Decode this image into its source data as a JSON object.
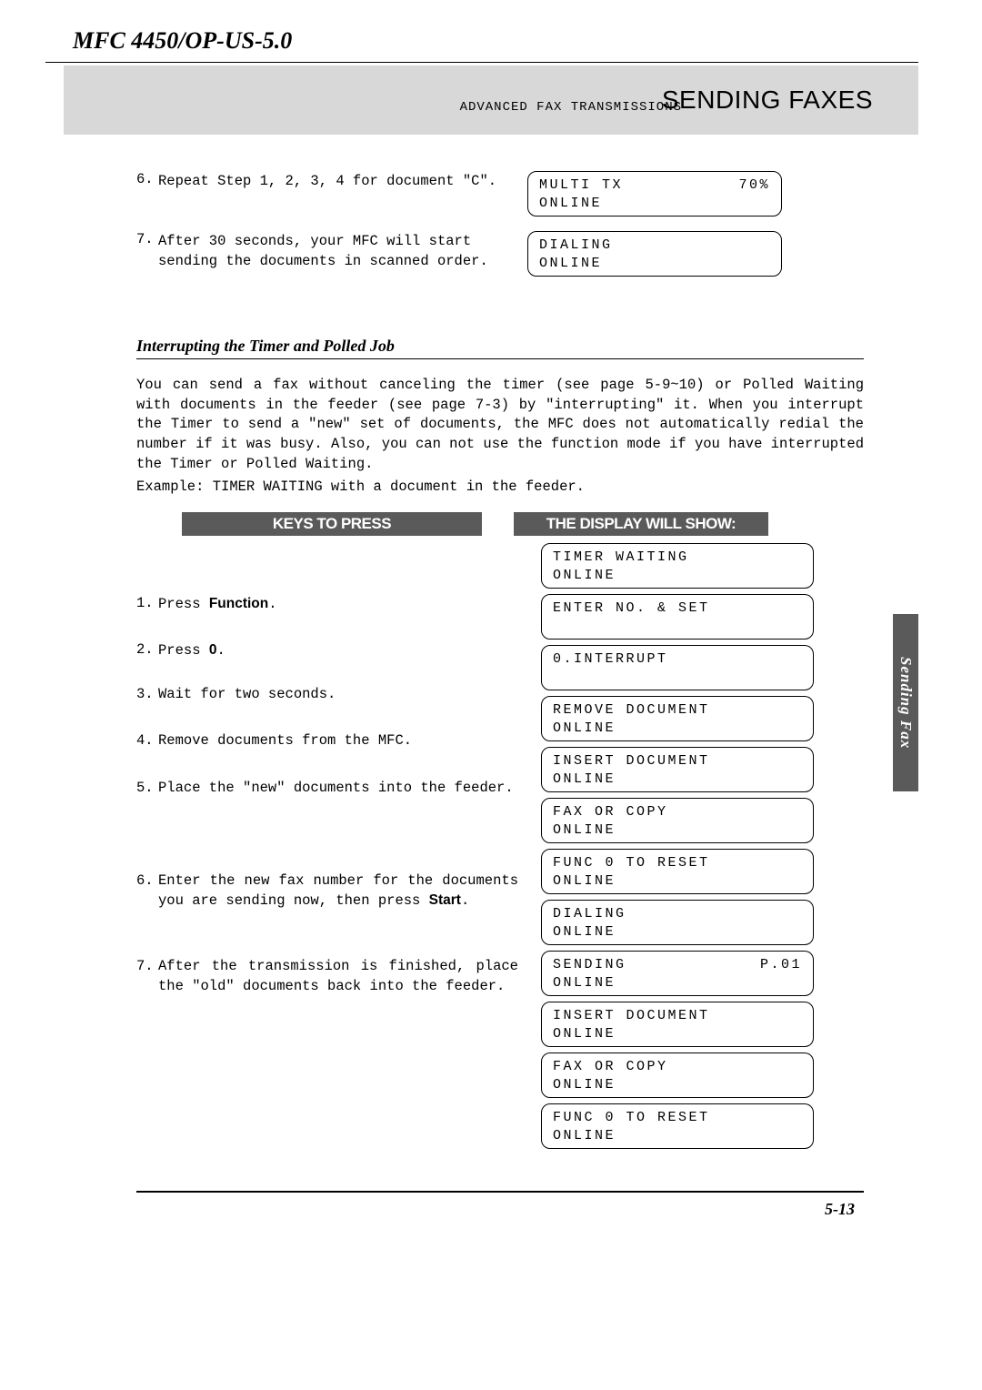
{
  "header": {
    "model": "MFC 4450/OP-US-5.0",
    "subheading": "ADVANCED FAX TRANSMISSIONS",
    "title": "SENDING FAXES"
  },
  "intro_steps": [
    {
      "n": "6.",
      "text_before": "Repeat Step 1, 2, 3, 4 for document ",
      "quoted": "\"C\"",
      "text_after": "."
    },
    {
      "n": "7.",
      "text_before": "After 30 seconds, your MFC will start sending the documents in scanned order.",
      "quoted": "",
      "text_after": ""
    }
  ],
  "intro_lcds": [
    {
      "line1_left": "MULTI TX",
      "line1_right": "70%",
      "line2": "ONLINE"
    },
    {
      "line1_left": "DIALING",
      "line1_right": "",
      "line2": "ONLINE"
    }
  ],
  "section": {
    "title": "Interrupting the Timer and Polled Job",
    "para1": "You can send a fax without canceling the timer (see page 5-9~10) or Polled Waiting with documents in the feeder (see page 7-3) by \"interrupting\" it. When you interrupt the Timer to send a \"new\" set of documents, the MFC does not automatically redial the number if it was busy. Also, you can not use the function mode if you have interrupted the Timer or Polled Waiting.",
    "para2": "Example: TIMER WAITING with a document in the feeder."
  },
  "table": {
    "left_header": "KEYS TO PRESS",
    "right_header": "THE DISPLAY WILL SHOW:"
  },
  "lcds": [
    {
      "l1": "TIMER  WAITING",
      "l2": "ONLINE"
    },
    {
      "l1": "ENTER  NO.  &  SET",
      "l2": ""
    },
    {
      "l1": "0.INTERRUPT",
      "l2": ""
    },
    {
      "l1": "REMOVE  DOCUMENT",
      "l2": "ONLINE"
    },
    {
      "l1": "INSERT  DOCUMENT",
      "l2": "ONLINE"
    },
    {
      "l1": "FAX  OR  COPY",
      "l2": "ONLINE"
    },
    {
      "l1": "FUNC  0  TO  RESET",
      "l2": "ONLINE"
    },
    {
      "l1": "DIALING",
      "l2": "ONLINE"
    },
    {
      "l1_left": "SENDING",
      "l1_right": "P.01",
      "l2": "ONLINE"
    },
    {
      "l1": "INSERT  DOCUMENT",
      "l2": "ONLINE"
    },
    {
      "l1": "FAX  OR  COPY",
      "l2": "ONLINE"
    },
    {
      "l1": "FUNC  0  TO  RESET",
      "l2": "ONLINE"
    }
  ],
  "steps": [
    {
      "n": "1.",
      "pre": "Press ",
      "bold": "Function",
      "post": "."
    },
    {
      "n": "2.",
      "pre": "Press ",
      "bold": "0",
      "post": "."
    },
    {
      "n": "3.",
      "pre": "Wait for two seconds.",
      "bold": "",
      "post": ""
    },
    {
      "n": "4.",
      "pre": "Remove documents from the MFC.",
      "bold": "",
      "post": ""
    },
    {
      "n": "5.",
      "pre": "Place the \"new\" documents into the feeder.",
      "bold": "",
      "post": ""
    },
    {
      "n": "6.",
      "pre": "Enter the new fax number for the documents you are sending now, then press ",
      "bold": "Start",
      "post": "."
    },
    {
      "n": "7.",
      "pre": "After the transmission is finished, place the \"old\" documents back into the feeder.",
      "bold": "",
      "post": ""
    }
  ],
  "side_tab": "Sending Fax",
  "page_number": "5-13"
}
